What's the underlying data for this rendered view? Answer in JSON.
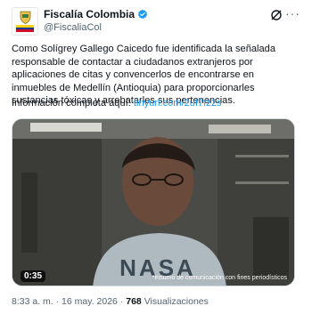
{
  "author": {
    "display_name": "Fiscalía Colombia",
    "handle": "@FiscaliaCol"
  },
  "tweet": {
    "text": "Como Solígrey Gallego Caicedo fue identificada la señalada responsable de contactar a ciudadanos extranjeros por aplicaciones de citas y convencerlos de encontrarse en inmuebles de Medellín (Antioquia) para proporcionarles sustancias tóxicas y arrebatarles sus pertenencias.",
    "info_label": "Información completa aquí:",
    "link": "tinyurl.com/2uf7fz2s"
  },
  "video": {
    "duration": "0:35",
    "caption": "*Insumo de comunicación con fines periodísticos",
    "shirt_text": "NASA"
  },
  "meta": {
    "time": "8:33 a. m.",
    "sep": "·",
    "date": "16 may. 2026",
    "views_count": "768",
    "views_label": "Visualizaciones"
  },
  "colors": {
    "link": "#1d9bf0",
    "verified": "#1d9bf0",
    "flag_yellow": "#fcd116",
    "flag_blue": "#003893",
    "flag_red": "#ce1126"
  },
  "icons": [
    "verified-badge-icon",
    "grok-icon",
    "more-options-icon",
    "shield-logo-icon"
  ]
}
